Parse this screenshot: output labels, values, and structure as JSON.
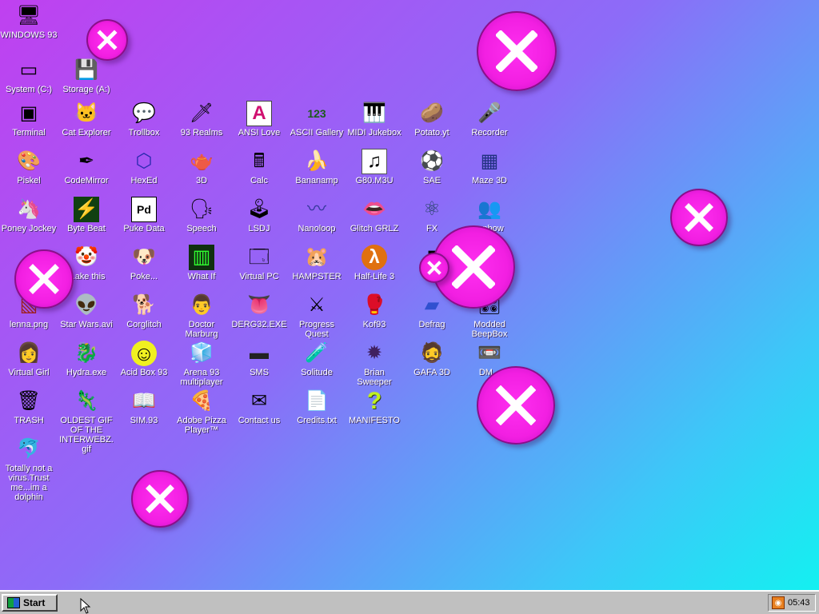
{
  "desktop": {
    "icons": [
      {
        "id": "windows93",
        "label": "WINDOWS 93",
        "glyph": "🖥"
      },
      {
        "id": "system-c",
        "label": "System (C:)",
        "glyph": "▭"
      },
      {
        "id": "storage-a",
        "label": "Storage (A:)",
        "glyph": "💾"
      },
      {
        "id": "terminal",
        "label": "Terminal",
        "glyph": "▣"
      },
      {
        "id": "cat-explorer",
        "label": "Cat Explorer",
        "glyph": "🐱"
      },
      {
        "id": "trollbox",
        "label": "Trollbox",
        "glyph": "💬"
      },
      {
        "id": "93-realms",
        "label": "93 Realms",
        "glyph": "🗡"
      },
      {
        "id": "ansi-love",
        "label": "ANSI Love",
        "glyph": "A"
      },
      {
        "id": "ascii-gallery",
        "label": "ASCII Gallery",
        "glyph": "123"
      },
      {
        "id": "midi-jukebox",
        "label": "MIDI Jukebox",
        "glyph": "🎹"
      },
      {
        "id": "potato-yt",
        "label": "Potato.yt",
        "glyph": "🥔"
      },
      {
        "id": "recorder",
        "label": "Recorder",
        "glyph": "🎤"
      },
      {
        "id": "piskel",
        "label": "Piskel",
        "glyph": "🎨"
      },
      {
        "id": "codemirror",
        "label": "CodeMirror",
        "glyph": "✒"
      },
      {
        "id": "hexed",
        "label": "HexEd",
        "glyph": "⬡"
      },
      {
        "id": "3d",
        "label": "3D",
        "glyph": "🫖"
      },
      {
        "id": "calc",
        "label": "Calc",
        "glyph": "🖩"
      },
      {
        "id": "bananamp",
        "label": "Bananamp",
        "glyph": "🍌"
      },
      {
        "id": "g80-m3u",
        "label": "G80.M3U",
        "glyph": "♫"
      },
      {
        "id": "sae",
        "label": "SAE",
        "glyph": "⚽"
      },
      {
        "id": "maze-3d",
        "label": "Maze 3D",
        "glyph": "▦"
      },
      {
        "id": "poney-jockey",
        "label": "Poney Jockey",
        "glyph": "🦄"
      },
      {
        "id": "byte-beat",
        "label": "Byte Beat",
        "glyph": "⚡"
      },
      {
        "id": "puke-data",
        "label": "Puke Data",
        "glyph": "Pd"
      },
      {
        "id": "speech",
        "label": "Speech",
        "glyph": "🗣"
      },
      {
        "id": "lsdj",
        "label": "LSDJ",
        "glyph": "🕹"
      },
      {
        "id": "nanoloop",
        "label": "Nanoloop",
        "glyph": "〰"
      },
      {
        "id": "glitch-grlz",
        "label": "Glitch GRLZ",
        "glyph": "👄"
      },
      {
        "id": "fx",
        "label": "FX",
        "glyph": "⚛"
      },
      {
        "id": "rainbow",
        "label": "...nbow",
        "glyph": "👥"
      },
      {
        "id": "fake-this",
        "label": "...ake this",
        "glyph": "🤡"
      },
      {
        "id": "pokedex",
        "label": "Poke...",
        "glyph": "🐶"
      },
      {
        "id": "what-if",
        "label": "What If",
        "glyph": "▥"
      },
      {
        "id": "virtual-pc",
        "label": "Virtual PC",
        "glyph": "🗔"
      },
      {
        "id": "hampster",
        "label": "HAMPSTER",
        "glyph": "🐹"
      },
      {
        "id": "half-life-3",
        "label": "Half-Life 3",
        "glyph": "λ"
      },
      {
        "id": "d-hidden",
        "label": "D...",
        "glyph": "▮"
      },
      {
        "id": "lenna",
        "label": "lenna.png",
        "glyph": "▧"
      },
      {
        "id": "star-wars",
        "label": "Star Wars.avi",
        "glyph": "👽"
      },
      {
        "id": "corglitch",
        "label": "Corglitch",
        "glyph": "🐕"
      },
      {
        "id": "doctor-marburg",
        "label": "Doctor Marburg",
        "glyph": "👨"
      },
      {
        "id": "derg32",
        "label": "DERG32.EXE",
        "glyph": "👅"
      },
      {
        "id": "progress-quest",
        "label": "Progress Quest",
        "glyph": "⚔"
      },
      {
        "id": "kof93",
        "label": "Kof93",
        "glyph": "🥊"
      },
      {
        "id": "defrag",
        "label": "Defrag",
        "glyph": "▰"
      },
      {
        "id": "modded-beepbox",
        "label": "Modded BeepBox",
        "glyph": "🎛"
      },
      {
        "id": "virtual-girl",
        "label": "Virtual Girl",
        "glyph": "👩"
      },
      {
        "id": "hydra-exe",
        "label": "Hydra.exe",
        "glyph": "🐉"
      },
      {
        "id": "acid-box-93",
        "label": "Acid Box 93",
        "glyph": "☺"
      },
      {
        "id": "arena-93",
        "label": "Arena 93 multiplayer",
        "glyph": "🧊"
      },
      {
        "id": "sms",
        "label": "SMS",
        "glyph": "▬"
      },
      {
        "id": "solitude",
        "label": "Solitude",
        "glyph": "🧪"
      },
      {
        "id": "brian-sweeper",
        "label": "Brian Sweeper",
        "glyph": "✹"
      },
      {
        "id": "gafa-3d",
        "label": "GAFA 3D",
        "glyph": "🧔"
      },
      {
        "id": "dm",
        "label": "DM...",
        "glyph": "📼"
      },
      {
        "id": "trash",
        "label": "TRASH",
        "glyph": "🗑"
      },
      {
        "id": "oldest-gif",
        "label": "OLDEST GIF OF THE INTERWEBZ.gif",
        "glyph": "🦎"
      },
      {
        "id": "sim93",
        "label": "SIM.93",
        "glyph": "📖"
      },
      {
        "id": "adobe-pizza",
        "label": "Adobe Pizza Player™",
        "glyph": "🍕"
      },
      {
        "id": "contact-us",
        "label": "Contact us",
        "glyph": "✉"
      },
      {
        "id": "credits",
        "label": "Credits.txt",
        "glyph": "📄"
      },
      {
        "id": "manifesto",
        "label": "MANIFESTO",
        "glyph": "?"
      },
      {
        "id": "dolphin",
        "label": "Totally not a virus.Trust me...im a dolphin",
        "glyph": "🐬"
      }
    ],
    "bubbles_glyph": "close-x-icon"
  },
  "taskbar": {
    "start_label": "Start",
    "clock": "05:43",
    "tray_icon": "rss-icon"
  },
  "colors": {
    "bubble": "#f21fe2",
    "gradient_start": "#c040f0",
    "gradient_end": "#10f4f0",
    "taskbar": "#c0c0c0"
  }
}
